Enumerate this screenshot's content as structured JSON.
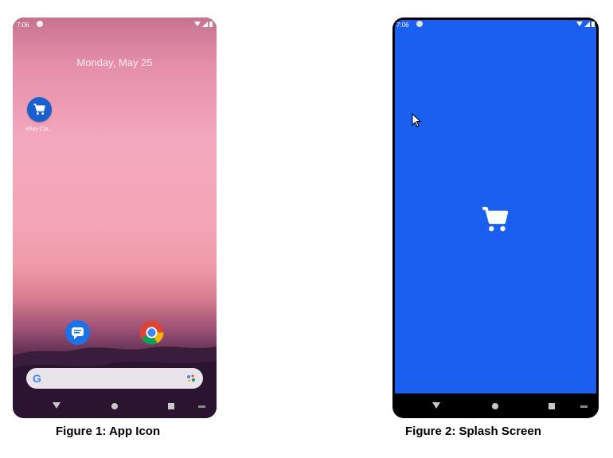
{
  "figure1": {
    "caption": "Figure 1: App Icon",
    "status_time": "7:06",
    "date": "Monday, May 25",
    "app_label": "eBay Cla...",
    "app_icon": "shopping-cart-icon",
    "dock": [
      "messages-icon",
      "chrome-icon"
    ],
    "search_logo": "G",
    "nav": [
      "back-icon",
      "home-icon",
      "recents-icon",
      "keyboard-icon"
    ]
  },
  "figure2": {
    "caption": "Figure 2: Splash Screen",
    "status_time": "7:06",
    "background_color": "#1a5ff0",
    "center_icon": "shopping-cart-icon",
    "nav": [
      "back-icon",
      "home-icon",
      "recents-icon",
      "keyboard-icon"
    ]
  }
}
